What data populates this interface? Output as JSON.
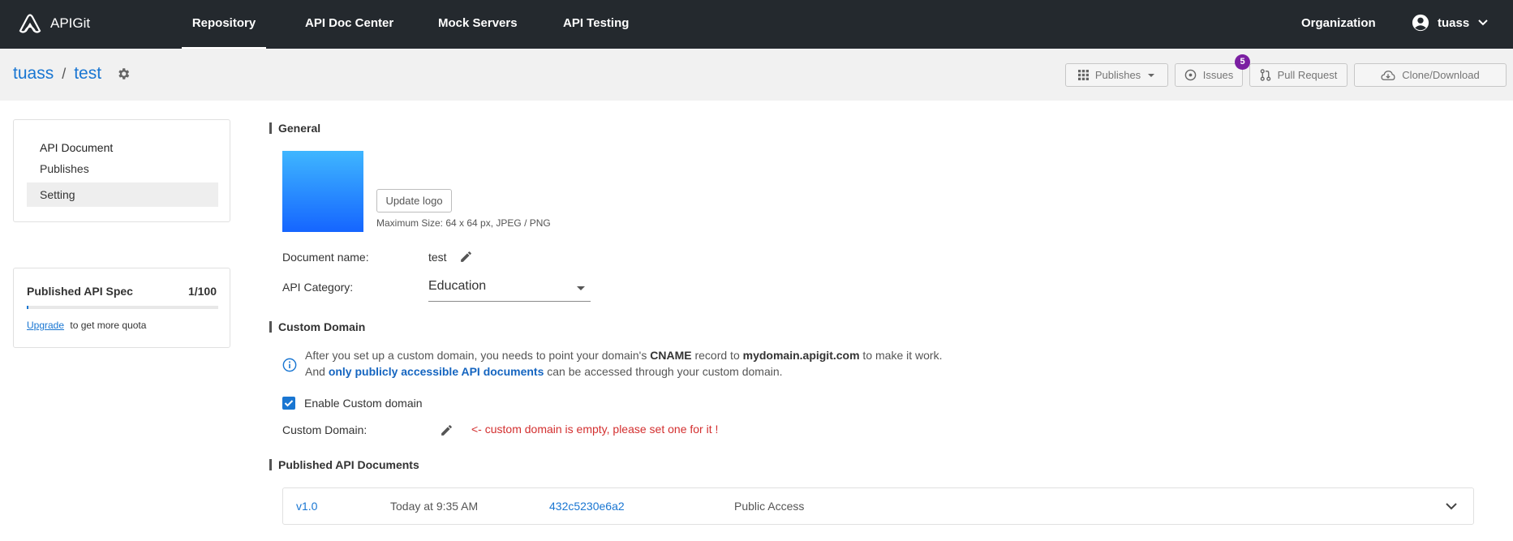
{
  "topnav": {
    "brand": "APIGit",
    "links": [
      {
        "label": "Repository",
        "active": true
      },
      {
        "label": "API Doc Center",
        "active": false
      },
      {
        "label": "Mock Servers",
        "active": false
      },
      {
        "label": "API Testing",
        "active": false
      }
    ],
    "organization": "Organization",
    "username": "tuass"
  },
  "repo": {
    "owner": "tuass",
    "separator": "/",
    "name": "test",
    "buttons": {
      "publishes": "Publishes",
      "issues": "Issues",
      "issues_count": "5",
      "pull_request": "Pull Request",
      "clone": "Clone/Download"
    }
  },
  "sidebar": {
    "heading": "API Document",
    "items": [
      "Publishes",
      "Setting"
    ],
    "selected": "Setting",
    "quota": {
      "title": "Published API Spec",
      "count": "1/100",
      "progress": 0.01,
      "upgrade_link": "Upgrade",
      "upgrade_text": "to get more quota"
    }
  },
  "general": {
    "title": "General",
    "update_logo": "Update logo",
    "logo_hint": "Maximum Size: 64 x 64 px, JPEG / PNG",
    "doc_name_label": "Document name:",
    "doc_name_value": "test",
    "category_label": "API Category:",
    "category_value": "Education"
  },
  "custom_domain": {
    "title": "Custom Domain",
    "info_1a": "After you set up a custom domain, you needs to point your domain's ",
    "info_cname": "CNAME",
    "info_1b": " record to ",
    "info_domain": "mydomain.apigit.com",
    "info_1c": " to make it work.",
    "info_2a": "And ",
    "info_2_link": "only publicly accessible API documents",
    "info_2b": " can be accessed through your custom domain.",
    "enable_label": "Enable Custom domain",
    "enabled": true,
    "domain_label": "Custom Domain:",
    "empty_warning": "<- custom domain is empty, please set one for it !"
  },
  "published": {
    "title": "Published API Documents",
    "rows": [
      {
        "version": "v1.0",
        "time": "Today at 9:35 AM",
        "commit": "432c5230e6a2",
        "access": "Public Access"
      }
    ]
  },
  "colors": {
    "nav_bg": "#24292e",
    "link": "#1976d2",
    "badge": "#7b1fa2",
    "error": "#d32f2f"
  }
}
